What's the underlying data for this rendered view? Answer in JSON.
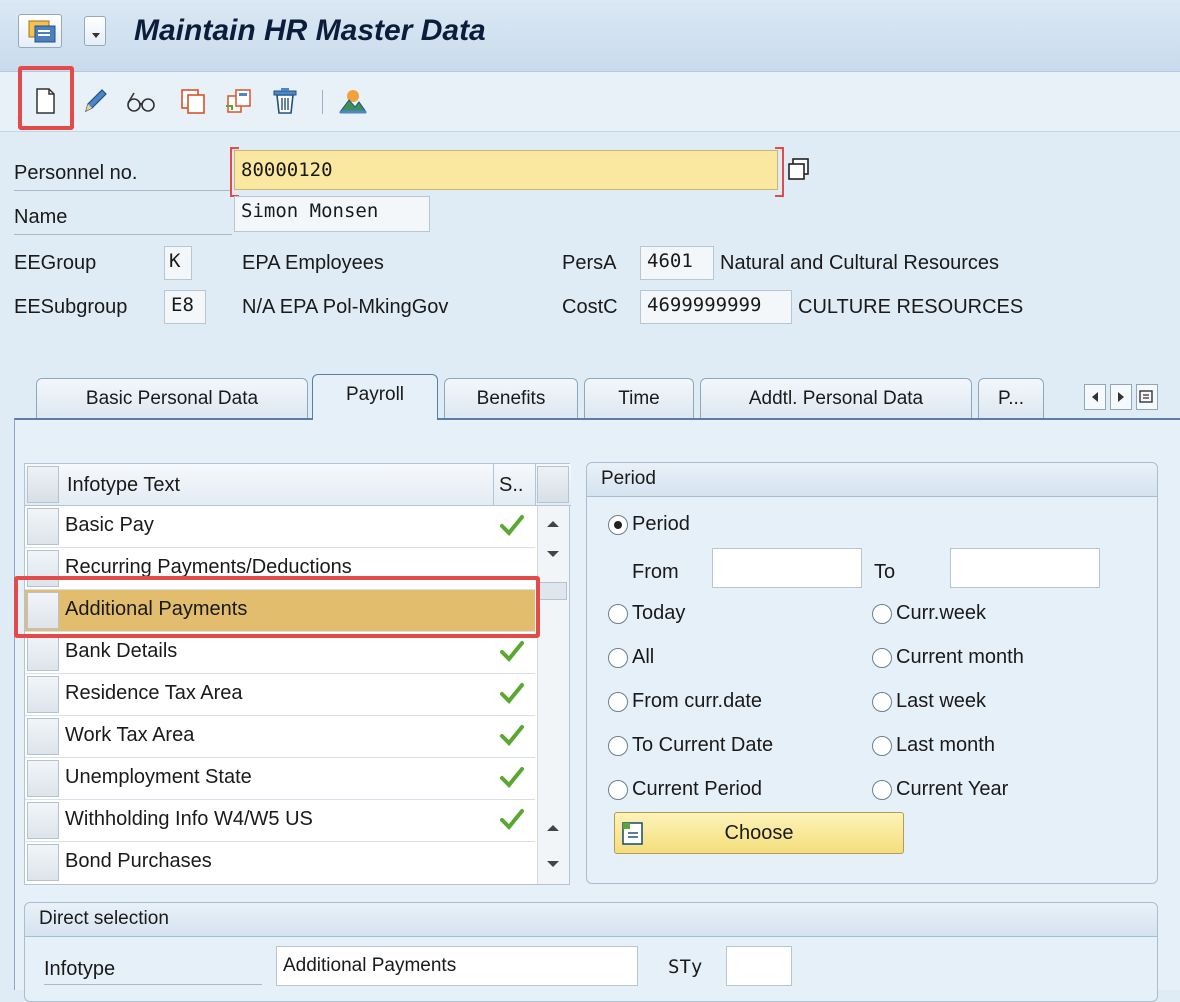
{
  "window": {
    "title": "Maintain HR Master Data"
  },
  "toolbar": {
    "buttons": [
      {
        "name": "create-icon",
        "tooltip": "Create"
      },
      {
        "name": "change-icon",
        "tooltip": "Change"
      },
      {
        "name": "display-icon",
        "tooltip": "Display"
      },
      {
        "name": "copy-icon",
        "tooltip": "Copy"
      },
      {
        "name": "delimit-icon",
        "tooltip": "Delimit"
      },
      {
        "name": "delete-icon",
        "tooltip": "Delete"
      },
      {
        "name": "overview-icon",
        "tooltip": "Overview"
      }
    ]
  },
  "header": {
    "personnel_no_label": "Personnel no.",
    "personnel_no": "80000120",
    "name_label": "Name",
    "name": "Simon Monsen",
    "eegroup_label": "EEGroup",
    "eegroup_code": "K",
    "eegroup_text": "EPA Employees",
    "eesubgroup_label": "EESubgroup",
    "eesubgroup_code": "E8",
    "eesubgroup_text": "N/A EPA Pol-MkingGov",
    "persa_label": "PersA",
    "persa_code": "4601",
    "persa_text": "Natural and Cultural Resources",
    "costc_label": "CostC",
    "costc_code": "4699999999",
    "costc_text": "CULTURE RESOURCES"
  },
  "tabs": [
    {
      "label": "Basic Personal Data",
      "active": false
    },
    {
      "label": "Payroll",
      "active": true
    },
    {
      "label": "Benefits",
      "active": false
    },
    {
      "label": "Time",
      "active": false
    },
    {
      "label": "Addtl. Personal Data",
      "active": false
    },
    {
      "label": "P...",
      "active": false
    }
  ],
  "infotypes": {
    "col_text": "Infotype Text",
    "col_status": "S..",
    "rows": [
      {
        "text": "Basic Pay",
        "status": "check"
      },
      {
        "text": "Recurring Payments/Deductions",
        "status": ""
      },
      {
        "text": "Additional Payments",
        "status": "",
        "selected": true
      },
      {
        "text": "Bank Details",
        "status": "check"
      },
      {
        "text": "Residence Tax Area",
        "status": "check"
      },
      {
        "text": "Work Tax Area",
        "status": "check"
      },
      {
        "text": "Unemployment State",
        "status": "check"
      },
      {
        "text": "Withholding Info W4/W5 US",
        "status": "check"
      },
      {
        "text": "Bond Purchases",
        "status": ""
      }
    ]
  },
  "period": {
    "title": "Period",
    "period_label": "Period",
    "from_label": "From",
    "from_value": "",
    "to_label": "To",
    "to_value": "",
    "options_left": [
      "Today",
      "All",
      "From curr.date",
      "To Current Date",
      "Current Period"
    ],
    "options_right": [
      "Curr.week",
      "Current month",
      "Last week",
      "Last month",
      "Current Year"
    ],
    "choose_label": "Choose"
  },
  "direct": {
    "title": "Direct selection",
    "infotype_label": "Infotype",
    "infotype_value": "Additional Payments",
    "sty_label": "STy",
    "sty_value": ""
  },
  "colors": {
    "highlight_red": "#e34a4a",
    "selected_row": "#e2bd6d",
    "check_green": "#5aa832",
    "yellow_field": "#fbe8a0"
  }
}
